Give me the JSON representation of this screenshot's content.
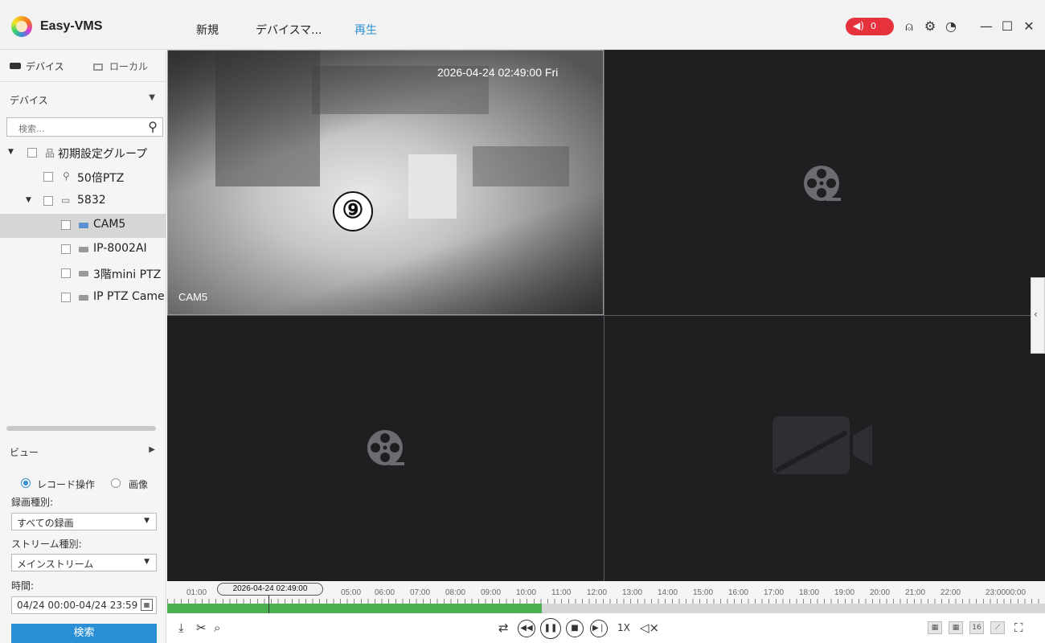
{
  "header": {
    "app_title": "Easy-VMS",
    "nav": [
      "新規",
      "デバイスマ...",
      "再生"
    ],
    "active_nav": "再生",
    "alarm_count": "0"
  },
  "sidebar": {
    "tabs": {
      "device": "デバイス",
      "local": "ローカル"
    },
    "device_section": "デバイス",
    "search_placeholder": "検索...",
    "tree": [
      {
        "label": "初期設定グループ",
        "type": "group"
      },
      {
        "label": "50倍PTZ",
        "type": "ptz"
      },
      {
        "label": "5832",
        "type": "nvr"
      },
      {
        "label": "CAM5",
        "type": "camera",
        "selected": true
      },
      {
        "label": "IP-8002AI",
        "type": "camera"
      },
      {
        "label": "3階mini PTZ",
        "type": "camera"
      },
      {
        "label": "IP PTZ Came",
        "type": "camera-offline"
      }
    ],
    "view_section": "ビュー",
    "radio": {
      "record": "レコード操作",
      "image": "画像"
    },
    "record_type_label": "録画種別:",
    "record_type_value": "すべての録画",
    "stream_type_label": "ストリーム種別:",
    "stream_type_value": "メインストリーム",
    "time_label": "時間:",
    "time_value": "04/24 00:00-04/24 23:59",
    "search_button": "検索"
  },
  "video": {
    "timestamp": "2026-04-24 02:49:00 Fri",
    "camera_name": "CAM5",
    "badge": "⑨"
  },
  "timeline": {
    "cursor_time": "2026-04-24 02:49:00",
    "hours": [
      "01:00",
      "05:00",
      "06:00",
      "07:00",
      "08:00",
      "09:00",
      "10:00",
      "11:00",
      "12:00",
      "13:00",
      "14:00",
      "15:00",
      "16:00",
      "17:00",
      "18:00",
      "19:00",
      "20:00",
      "21:00",
      "22:00",
      "23:0000:00"
    ]
  },
  "controls": {
    "speed": "1X",
    "layout_16": "16"
  },
  "colors": {
    "accent": "#2b8fd6",
    "alarm": "#e5323c",
    "recorded": "#4caf50",
    "grid_bg": "#1f1f22"
  }
}
